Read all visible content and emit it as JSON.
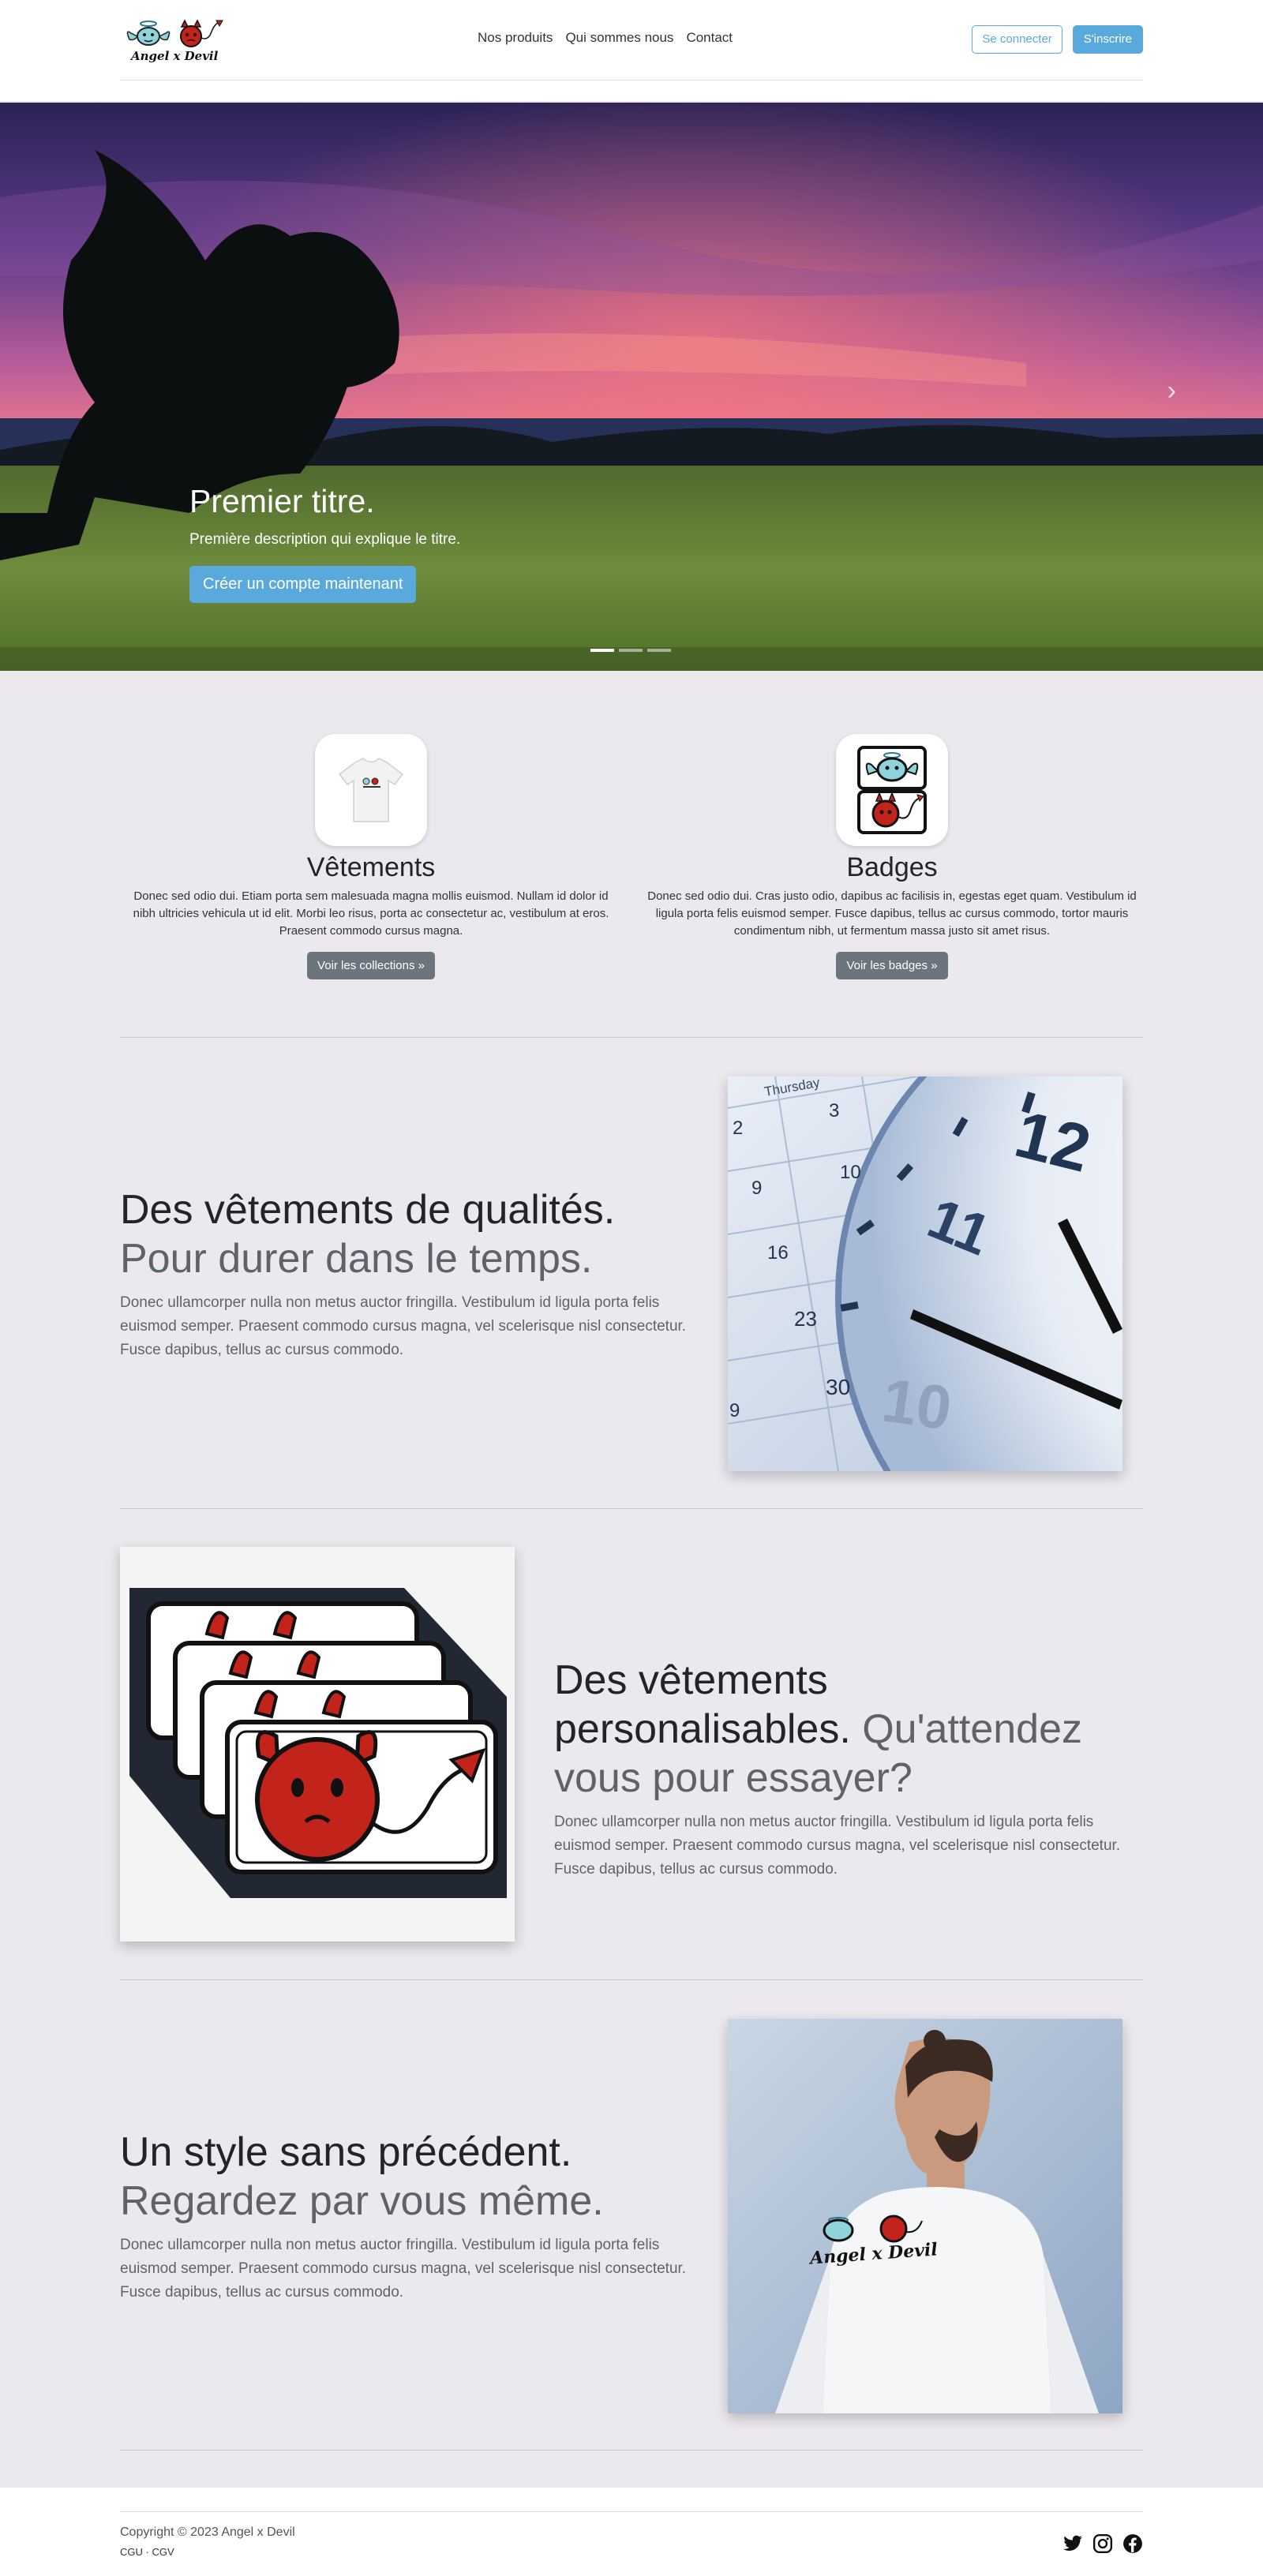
{
  "header": {
    "logo_text": "Angel x Devil",
    "nav": [
      "Nos produits",
      "Qui sommes nous",
      "Contact"
    ],
    "login": "Se connecter",
    "signup": "S'inscrire"
  },
  "hero": {
    "title": "Premier titre.",
    "description": "Première description qui explique le titre.",
    "cta": "Créer un compte maintenant",
    "next": "›"
  },
  "categories": [
    {
      "title": "Vêtements",
      "text": "Donec sed odio dui. Etiam porta sem malesuada magna mollis euismod. Nullam id dolor id nibh ultricies vehicula ut id elit. Morbi leo risus, porta ac consectetur ac, vestibulum at eros. Praesent commodo cursus magna.",
      "button": "Voir les collections »"
    },
    {
      "title": "Badges",
      "text": "Donec sed odio dui. Cras justo odio, dapibus ac facilisis in, egestas eget quam. Vestibulum id ligula porta felis euismod semper. Fusce dapibus, tellus ac cursus commodo, tortor mauris condimentum nibh, ut fermentum massa justo sit amet risus.",
      "button": "Voir les badges »"
    }
  ],
  "features": [
    {
      "heading": "Des vêtements de qualités.",
      "muted": "Pour durer dans le temps.",
      "text": "Donec ullamcorper nulla non metus auctor fringilla. Vestibulum id ligula porta felis euismod semper. Praesent commodo cursus magna, vel scelerisque nisl consectetur. Fusce dapibus, tellus ac cursus commodo."
    },
    {
      "heading": "Des vêtements personalisables.",
      "muted": "Qu'attendez vous pour essayer?",
      "text": "Donec ullamcorper nulla non metus auctor fringilla. Vestibulum id ligula porta felis euismod semper. Praesent commodo cursus magna, vel scelerisque nisl consectetur. Fusce dapibus, tellus ac cursus commodo."
    },
    {
      "heading": "Un style sans précédent.",
      "muted": "Regardez par vous même.",
      "text": "Donec ullamcorper nulla non metus auctor fringilla. Vestibulum id ligula porta felis euismod semper. Praesent commodo cursus magna, vel scelerisque nisl consectetur. Fusce dapibus, tellus ac cursus commodo."
    }
  ],
  "clock_numbers": [
    "12",
    "11",
    "10"
  ],
  "calendar": {
    "day": "Thursday",
    "dates": [
      "2",
      "3",
      "9",
      "10",
      "16",
      "23",
      "30",
      "9"
    ]
  },
  "footer": {
    "copyright": "Copyright © 2023 Angel x Devil",
    "legal": "CGU · CGV",
    "socials": [
      "twitter-icon",
      "instagram-icon",
      "facebook-icon"
    ]
  },
  "colors": {
    "accent": "#5aa9dd",
    "secondary": "#6c757d",
    "background": "#ebe9ee"
  }
}
